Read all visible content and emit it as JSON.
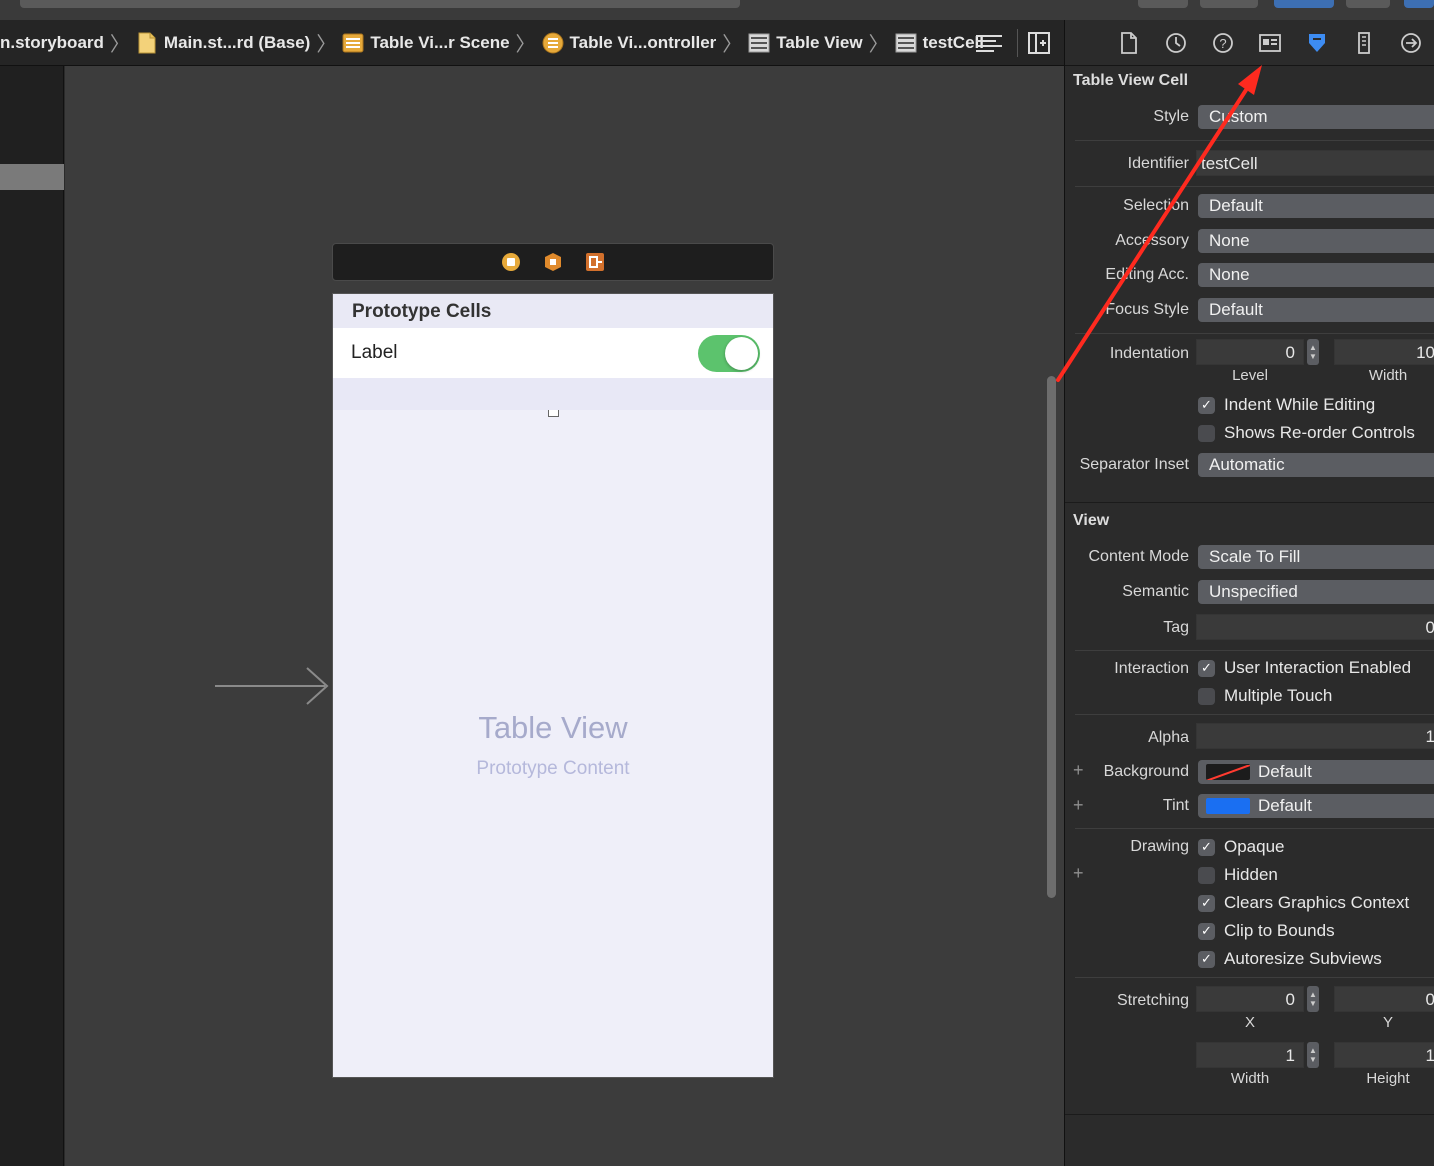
{
  "breadcrumbs": [
    {
      "label": "n.storyboard",
      "icon": "none"
    },
    {
      "label": "Main.st...rd (Base)",
      "icon": "storyboard-file-icon"
    },
    {
      "label": "Table Vi...r Scene",
      "icon": "scene-icon"
    },
    {
      "label": "Table Vi...ontroller",
      "icon": "view-controller-icon"
    },
    {
      "label": "Table View",
      "icon": "table-view-icon"
    },
    {
      "label": "testCell",
      "icon": "table-cell-icon"
    }
  ],
  "canvas": {
    "prototype_header": "Prototype Cells",
    "cell_label": "Label",
    "cell_switch_on": true,
    "table_view_title": "Table View",
    "table_view_subtitle": "Prototype Content"
  },
  "inspector": {
    "tabs": [
      "file-icon",
      "history-icon",
      "help-icon",
      "identity-icon",
      "attributes-icon",
      "size-icon",
      "connections-icon"
    ],
    "active_tab": "attributes-icon",
    "table_view_cell": {
      "title": "Table View Cell",
      "style_label": "Style",
      "style_value": "Custom",
      "identifier_label": "Identifier",
      "identifier_value": "testCell",
      "selection_label": "Selection",
      "selection_value": "Default",
      "accessory_label": "Accessory",
      "accessory_value": "None",
      "editing_acc_label": "Editing Acc.",
      "editing_acc_value": "None",
      "focus_style_label": "Focus Style",
      "focus_style_value": "Default",
      "indentation_label": "Indentation",
      "indentation_level": "0",
      "indentation_width": "10",
      "level_caption": "Level",
      "width_caption": "Width",
      "indent_while_editing": "Indent While Editing",
      "shows_reorder": "Shows Re-order Controls",
      "separator_inset_label": "Separator Inset",
      "separator_inset_value": "Automatic"
    },
    "view": {
      "title": "View",
      "content_mode_label": "Content Mode",
      "content_mode_value": "Scale To Fill",
      "semantic_label": "Semantic",
      "semantic_value": "Unspecified",
      "tag_label": "Tag",
      "tag_value": "0",
      "interaction_label": "Interaction",
      "user_interaction": "User Interaction Enabled",
      "multiple_touch": "Multiple Touch",
      "alpha_label": "Alpha",
      "alpha_value": "1",
      "background_label": "Background",
      "background_value": "Default",
      "tint_label": "Tint",
      "tint_value": "Default",
      "drawing_label": "Drawing",
      "opaque": "Opaque",
      "hidden": "Hidden",
      "clears_graphics": "Clears Graphics Context",
      "clip_to_bounds": "Clip to Bounds",
      "autoresize": "Autoresize Subviews",
      "stretching_label": "Stretching",
      "stretch_x": "0",
      "stretch_y": "0",
      "stretch_width": "1",
      "stretch_height": "1",
      "x_caption": "X",
      "y_caption": "Y",
      "width_caption": "Width",
      "height_caption": "Height",
      "plus": "+"
    }
  },
  "colors": {
    "annotation_arrow": "#ff2a1f",
    "switch_on": "#5cc36d",
    "tint_swatch": "#1a6ff2"
  }
}
